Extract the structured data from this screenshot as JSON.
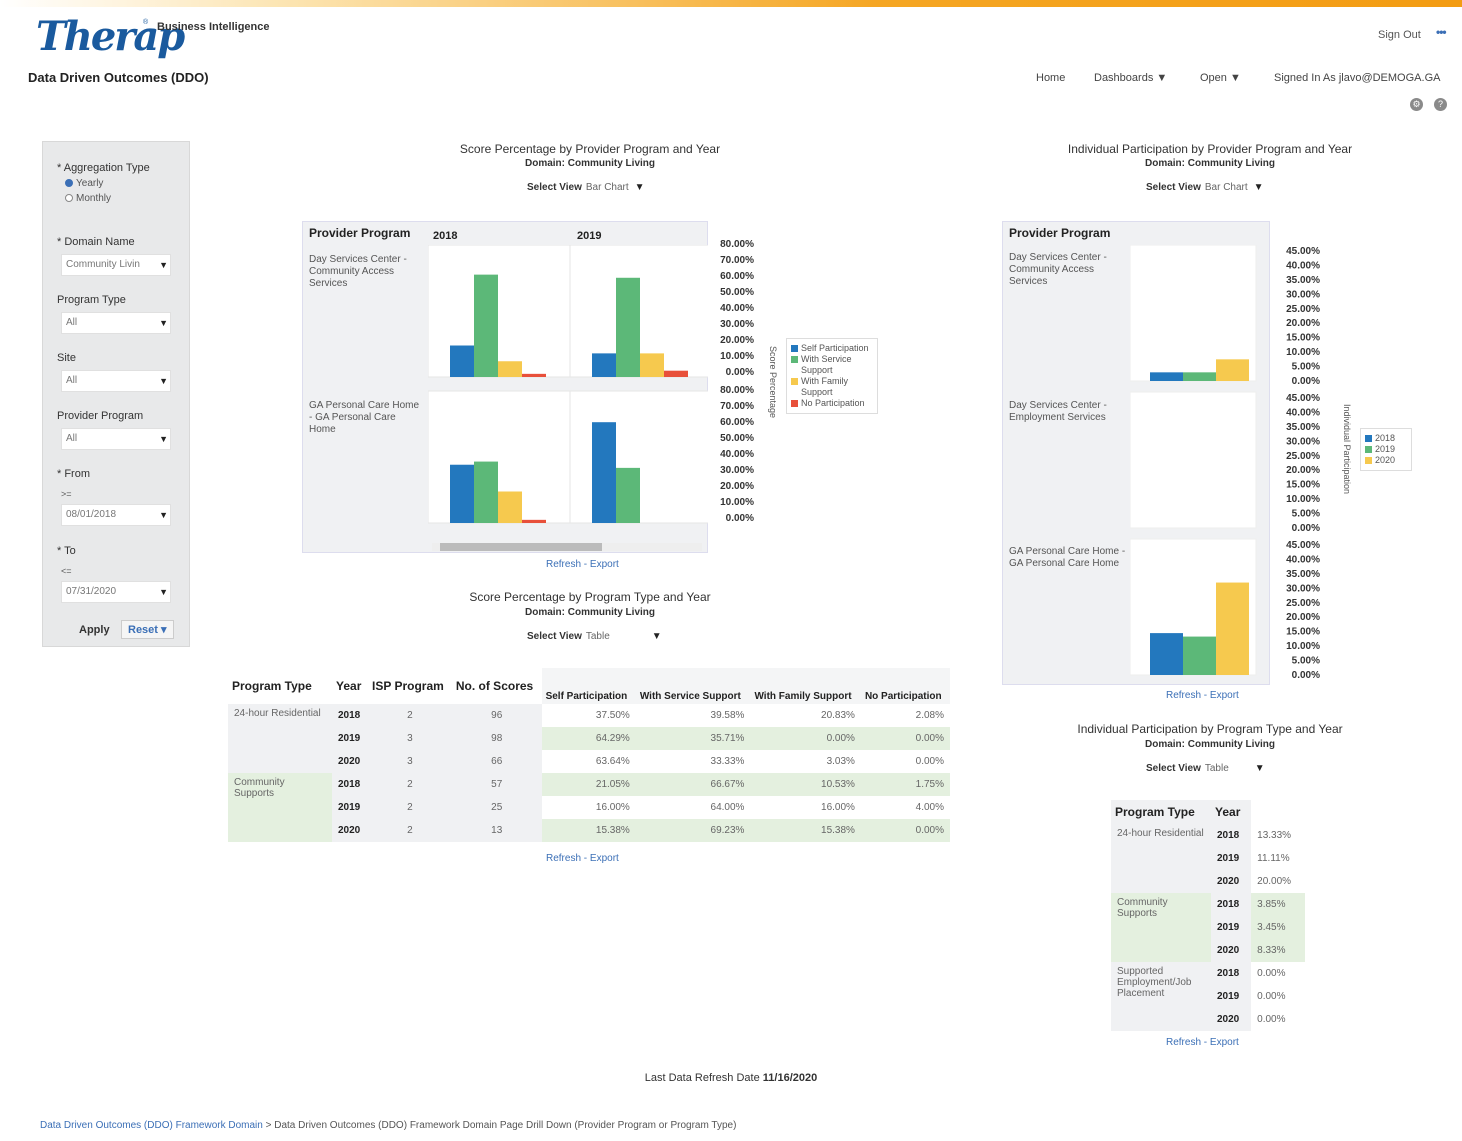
{
  "header": {
    "logo_text": "Therap",
    "logo_reg": "®",
    "app_name": "Business Intelligence",
    "sign_out": "Sign Out",
    "more": "•••"
  },
  "subheader": {
    "page_title": "Data Driven Outcomes (DDO)",
    "nav": {
      "home": "Home",
      "dashboards": "Dashboards ▼",
      "open": "Open ▼",
      "signed_in": "Signed In As  jlavo@DEMOGA.GA"
    }
  },
  "filters": {
    "aggregation_label": "* Aggregation Type",
    "aggregation_options": [
      "Yearly",
      "Monthly"
    ],
    "aggregation_selected": "Yearly",
    "domain_label": "* Domain Name",
    "domain_value": "Community Livin",
    "program_type_label": "Program Type",
    "program_type_value": "All",
    "site_label": "Site",
    "site_value": "All",
    "provider_label": "Provider Program",
    "provider_value": "All",
    "from_label": "* From",
    "from_op": ">=",
    "from_value": "08/01/2018",
    "to_label": "* To",
    "to_op": "<=",
    "to_value": "07/31/2020",
    "apply": "Apply",
    "reset": "Reset ▾"
  },
  "report1": {
    "title": "Score Percentage by Provider Program and Year",
    "subtitle": "Domain: Community Living",
    "select_view_label": "Select View",
    "select_view_value": "Bar Chart",
    "row_header": "Provider Program",
    "rows": [
      "Day Services Center - Community Access Services",
      "GA Personal Care Home - GA Personal Care Home"
    ],
    "years": [
      "2018",
      "2019"
    ],
    "y_axis_title": "Score Percentage",
    "refresh": "Refresh",
    "export": "Export"
  },
  "report2": {
    "title": "Individual Participation by Provider Program and Year",
    "subtitle": "Domain: Community Living",
    "select_view_label": "Select View",
    "select_view_value": "Bar Chart",
    "row_header": "Provider Program",
    "rows": [
      "Day Services Center - Community Access Services",
      "Day Services Center - Employment Services",
      "GA Personal Care Home - GA Personal Care Home"
    ],
    "y_axis_title": "Individual Participation",
    "refresh": "Refresh",
    "export": "Export"
  },
  "report3": {
    "title": "Score Percentage by Program Type and Year",
    "subtitle": "Domain: Community Living",
    "select_view_label": "Select View",
    "select_view_value": "Table",
    "columns": [
      "Program Type",
      "Year",
      "ISP Program",
      "No. of Scores",
      "Self Participation",
      "With Service Support",
      "With Family Support",
      "No Participation"
    ],
    "groups": [
      {
        "program_type": "24-hour Residential",
        "rows": [
          [
            "2018",
            "2",
            "96",
            "37.50%",
            "39.58%",
            "20.83%",
            "2.08%"
          ],
          [
            "2019",
            "3",
            "98",
            "64.29%",
            "35.71%",
            "0.00%",
            "0.00%"
          ],
          [
            "2020",
            "3",
            "66",
            "63.64%",
            "33.33%",
            "3.03%",
            "0.00%"
          ]
        ]
      },
      {
        "program_type": "Community Supports",
        "rows": [
          [
            "2018",
            "2",
            "57",
            "21.05%",
            "66.67%",
            "10.53%",
            "1.75%"
          ],
          [
            "2019",
            "2",
            "25",
            "16.00%",
            "64.00%",
            "16.00%",
            "4.00%"
          ],
          [
            "2020",
            "2",
            "13",
            "15.38%",
            "69.23%",
            "15.38%",
            "0.00%"
          ]
        ]
      }
    ],
    "refresh": "Refresh",
    "export": "Export"
  },
  "report4": {
    "title": "Individual Participation by Program Type and Year",
    "subtitle": "Domain: Community Living",
    "select_view_label": "Select View",
    "select_view_value": "Table",
    "columns": [
      "Program Type",
      "Year"
    ],
    "groups": [
      {
        "program_type": "24-hour Residential",
        "rows": [
          [
            "2018",
            "13.33%"
          ],
          [
            "2019",
            "11.11%"
          ],
          [
            "2020",
            "20.00%"
          ]
        ]
      },
      {
        "program_type": "Community Supports",
        "rows": [
          [
            "2018",
            "3.85%"
          ],
          [
            "2019",
            "3.45%"
          ],
          [
            "2020",
            "8.33%"
          ]
        ]
      },
      {
        "program_type": "Supported Employment/Job Placement",
        "rows": [
          [
            "2018",
            "0.00%"
          ],
          [
            "2019",
            "0.00%"
          ],
          [
            "2020",
            "0.00%"
          ]
        ]
      }
    ],
    "refresh": "Refresh",
    "export": "Export"
  },
  "chart_data": [
    {
      "type": "bar",
      "title": "Score Percentage by Provider Program and Year",
      "subtitle": "Domain: Community Living",
      "ylabel": "Score Percentage",
      "ylim": [
        0,
        80
      ],
      "y_ticks": [
        "80.00%",
        "70.00%",
        "60.00%",
        "50.00%",
        "40.00%",
        "30.00%",
        "20.00%",
        "10.00%",
        "0.00%"
      ],
      "legend": [
        "Self Participation",
        "With Service Support",
        "With Family Support",
        "No Participation"
      ],
      "legend_colors": [
        "#2378be",
        "#5cb878",
        "#f6c94e",
        "#e8503a"
      ],
      "panels": [
        {
          "row": "Day Services Center - Community Access Services",
          "year": "2018",
          "values": [
            20,
            65,
            10,
            2
          ]
        },
        {
          "row": "Day Services Center - Community Access Services",
          "year": "2019",
          "values": [
            15,
            63,
            15,
            4
          ]
        },
        {
          "row": "GA Personal Care Home - GA Personal Care Home",
          "year": "2018",
          "values": [
            37,
            39,
            20,
            2
          ]
        },
        {
          "row": "GA Personal Care Home - GA Personal Care Home",
          "year": "2019",
          "values": [
            64,
            35,
            0,
            0
          ]
        }
      ]
    },
    {
      "type": "bar",
      "title": "Individual Participation by Provider Program and Year",
      "subtitle": "Domain: Community Living",
      "ylabel": "Individual Participation",
      "ylim": [
        0,
        45
      ],
      "y_ticks": [
        "45.00%",
        "40.00%",
        "35.00%",
        "30.00%",
        "25.00%",
        "20.00%",
        "15.00%",
        "10.00%",
        "5.00%",
        "0.00%"
      ],
      "legend": [
        "2018",
        "2019",
        "2020"
      ],
      "legend_colors": [
        "#2378be",
        "#5cb878",
        "#f6c94e"
      ],
      "panels": [
        {
          "row": "Day Services Center - Community Access Services",
          "values": [
            3,
            3,
            7.5
          ]
        },
        {
          "row": "Day Services Center - Employment Services",
          "values": [
            0,
            0,
            0
          ]
        },
        {
          "row": "GA Personal Care Home - GA Personal Care Home",
          "values": [
            14.5,
            13.3,
            32
          ]
        }
      ]
    }
  ],
  "footer": {
    "last_refresh_label": "Last Data Refresh Date",
    "last_refresh_value": "11/16/2020",
    "breadcrumb_1": "Data Driven Outcomes (DDO) Framework Domain",
    "breadcrumb_sep": ">",
    "breadcrumb_2": "Data Driven Outcomes (DDO) Framework Domain Page Drill Down (Provider Program or Program Type)"
  }
}
